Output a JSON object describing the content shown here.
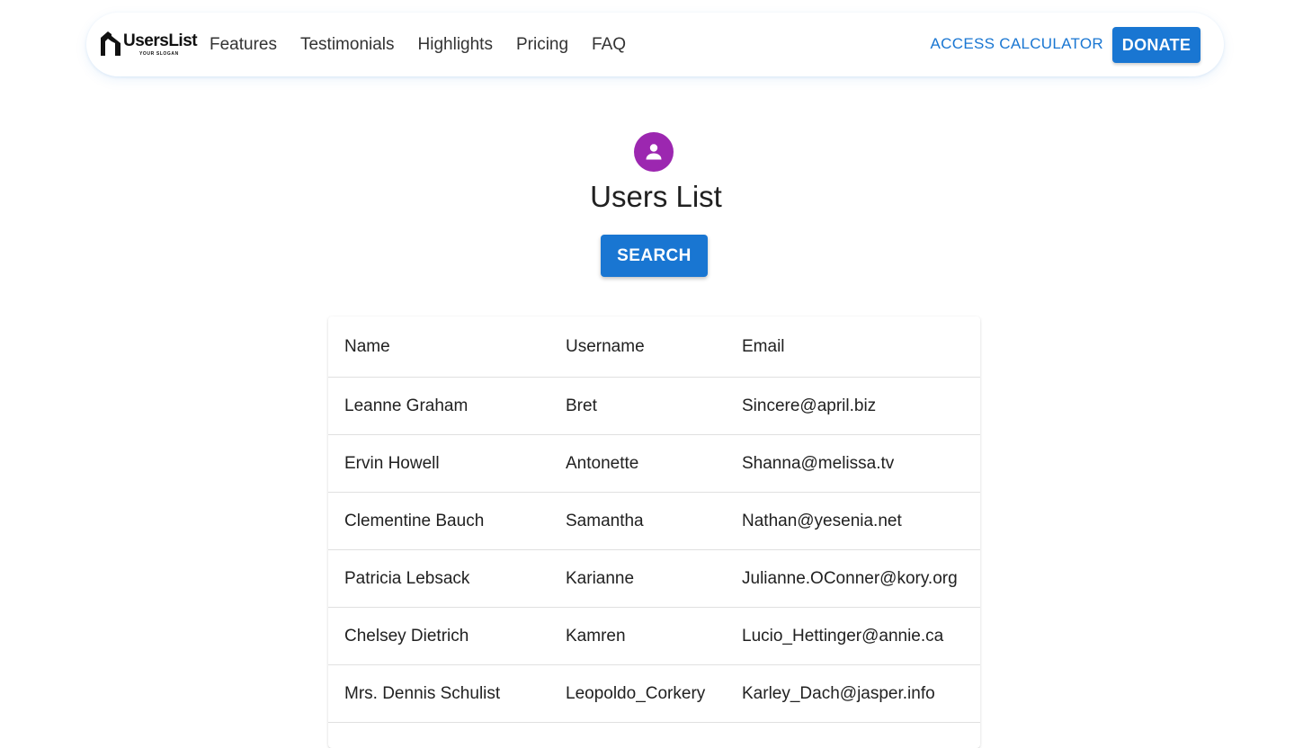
{
  "navbar": {
    "logo_text": "UsersList",
    "logo_slogan": "YOUR SLOGAN",
    "links": [
      "Features",
      "Testimonials",
      "Highlights",
      "Pricing",
      "FAQ"
    ],
    "access_label": "ACCESS CALCULATOR",
    "donate_label": "DONATE"
  },
  "main": {
    "title": "Users List",
    "search_label": "SEARCH"
  },
  "table": {
    "headers": [
      "Name",
      "Username",
      "Email"
    ],
    "rows": [
      [
        "Leanne Graham",
        "Bret",
        "Sincere@april.biz"
      ],
      [
        "Ervin Howell",
        "Antonette",
        "Shanna@melissa.tv"
      ],
      [
        "Clementine Bauch",
        "Samantha",
        "Nathan@yesenia.net"
      ],
      [
        "Patricia Lebsack",
        "Karianne",
        "Julianne.OConner@kory.org"
      ],
      [
        "Chelsey Dietrich",
        "Kamren",
        "Lucio_Hettinger@annie.ca"
      ],
      [
        "Mrs. Dennis Schulist",
        "Leopoldo_Corkery",
        "Karley_Dach@jasper.info"
      ]
    ]
  },
  "icons": {
    "logo": "userslist-logo-icon",
    "avatar": "person-icon"
  },
  "colors": {
    "primary": "#1976d2",
    "avatar_bg": "#9c27b0"
  }
}
